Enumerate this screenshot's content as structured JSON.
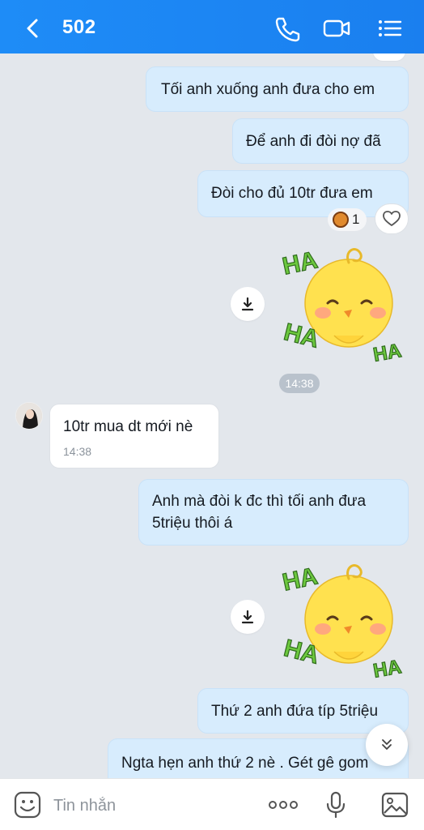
{
  "header": {
    "title": "502"
  },
  "messages": [
    {
      "text": "Tối anh xuống anh đưa cho em"
    },
    {
      "text": "Để anh đi đòi nợ đã"
    },
    {
      "text": "Đòi cho đủ 10tr đưa em"
    },
    {
      "text": "10tr mua dt mới nè",
      "time": "14:38"
    },
    {
      "text_line1": "Anh mà đòi k đc thì tối anh đưa",
      "text_line2": "5triệu thôi á"
    },
    {
      "text": "Thứ 2 anh đứa típ 5triệu"
    },
    {
      "text": "Ngta hẹn anh thứ 2 nè . Gét gê gom"
    }
  ],
  "reaction": {
    "count": "1"
  },
  "stickers": [
    {
      "text_top": "HA",
      "text_bottom_left": "HA",
      "text_bottom_right": "HA"
    },
    {
      "text_top": "HA",
      "text_bottom_left": "HA",
      "text_bottom_right": "HA"
    }
  ],
  "time_divider": "14:38",
  "input": {
    "placeholder": "Tin nhắn"
  },
  "colors": {
    "header": "#1e8cf7",
    "outgoing_bubble": "#d7ecfd",
    "incoming_bubble": "#ffffff",
    "chat_bg": "#e3e7ec",
    "sticker_green": "#6cc83e",
    "sticker_yellow": "#ffe14f"
  }
}
